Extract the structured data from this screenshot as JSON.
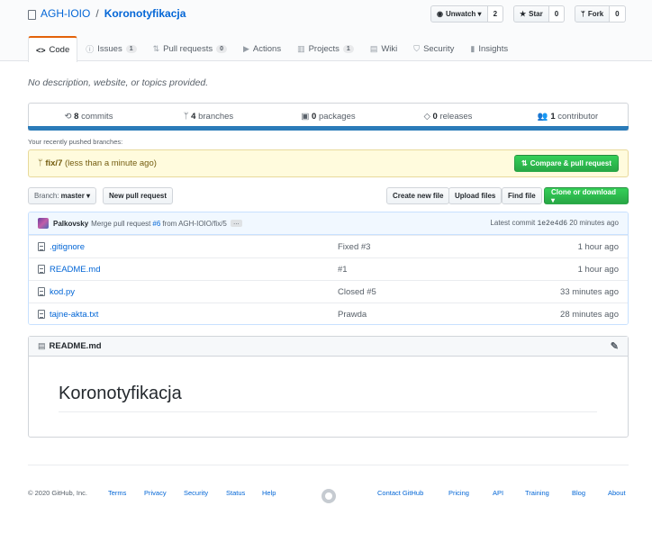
{
  "repo": {
    "owner": "AGH-IOIO",
    "separator": "/",
    "name": "Koronotyfikacja"
  },
  "header_actions": {
    "watch": {
      "icon": "eye-icon",
      "label": "Unwatch ▾",
      "count": "2"
    },
    "star": {
      "icon": "star-icon",
      "label": "Star",
      "count": "0"
    },
    "fork": {
      "icon": "fork-icon",
      "label": "Fork",
      "count": "0"
    }
  },
  "tabs": [
    {
      "icon": "code-icon",
      "label": "Code",
      "active": true
    },
    {
      "icon": "issue-icon",
      "label": "Issues",
      "badge": "1"
    },
    {
      "icon": "pull-request-icon",
      "label": "Pull requests",
      "badge": "0"
    },
    {
      "icon": "play-icon",
      "label": "Actions"
    },
    {
      "icon": "project-icon",
      "label": "Projects",
      "badge": "1"
    },
    {
      "icon": "book-icon",
      "label": "Wiki"
    },
    {
      "icon": "shield-icon",
      "label": "Security"
    },
    {
      "icon": "graph-icon",
      "label": "Insights"
    }
  ],
  "description": "No description, website, or topics provided.",
  "summary": [
    {
      "icon": "history-icon",
      "count": "8",
      "label": "commits"
    },
    {
      "icon": "branch-icon",
      "count": "4",
      "label": "branches"
    },
    {
      "icon": "package-icon",
      "count": "0",
      "label": "packages"
    },
    {
      "icon": "tag-icon",
      "count": "0",
      "label": "releases"
    },
    {
      "icon": "people-icon",
      "count": "1",
      "label": "contributor"
    }
  ],
  "summary_bar_color": "#2b7bb9",
  "pushed": {
    "label": "Your recently pushed branches:",
    "branch": "fix/7",
    "age": "(less than a minute ago)",
    "compare_label": "Compare & pull request"
  },
  "toolbar": {
    "branch_label": "Branch:",
    "branch_value": "master ▾",
    "new_pr": "New pull request",
    "create_file": "Create new file",
    "upload": "Upload files",
    "find": "Find file",
    "clone": "Clone or download ▾"
  },
  "latest_commit": {
    "author": "Palkovsky",
    "message_pre": "Merge pull request",
    "pr_link": "#6",
    "message_post": "from AGH-IOIO/fix/5",
    "ellipsis": "…",
    "latest_label": "Latest commit",
    "sha": "1e2e4d6",
    "age": "20 minutes ago"
  },
  "files": [
    {
      "name": ".gitignore",
      "message": "Fixed #3",
      "age": "1 hour ago"
    },
    {
      "name": "README.md",
      "message": "#1",
      "age": "1 hour ago"
    },
    {
      "name": "kod.py",
      "message": "Closed #5",
      "age": "33 minutes ago"
    },
    {
      "name": "tajne-akta.txt",
      "message": "Prawda",
      "age": "28 minutes ago"
    }
  ],
  "readme": {
    "filename": "README.md",
    "heading": "Koronotyfikacja"
  },
  "footer": {
    "copyright": "© 2020 GitHub, Inc.",
    "left_links": [
      "Terms",
      "Privacy",
      "Security",
      "Status",
      "Help"
    ],
    "right_links": [
      "Contact GitHub",
      "Pricing",
      "API",
      "Training",
      "Blog",
      "About"
    ]
  },
  "colors": {
    "link": "#0366d6",
    "active_tab": "#e36209",
    "green": "#28a745",
    "banner": "#fffbdd"
  }
}
